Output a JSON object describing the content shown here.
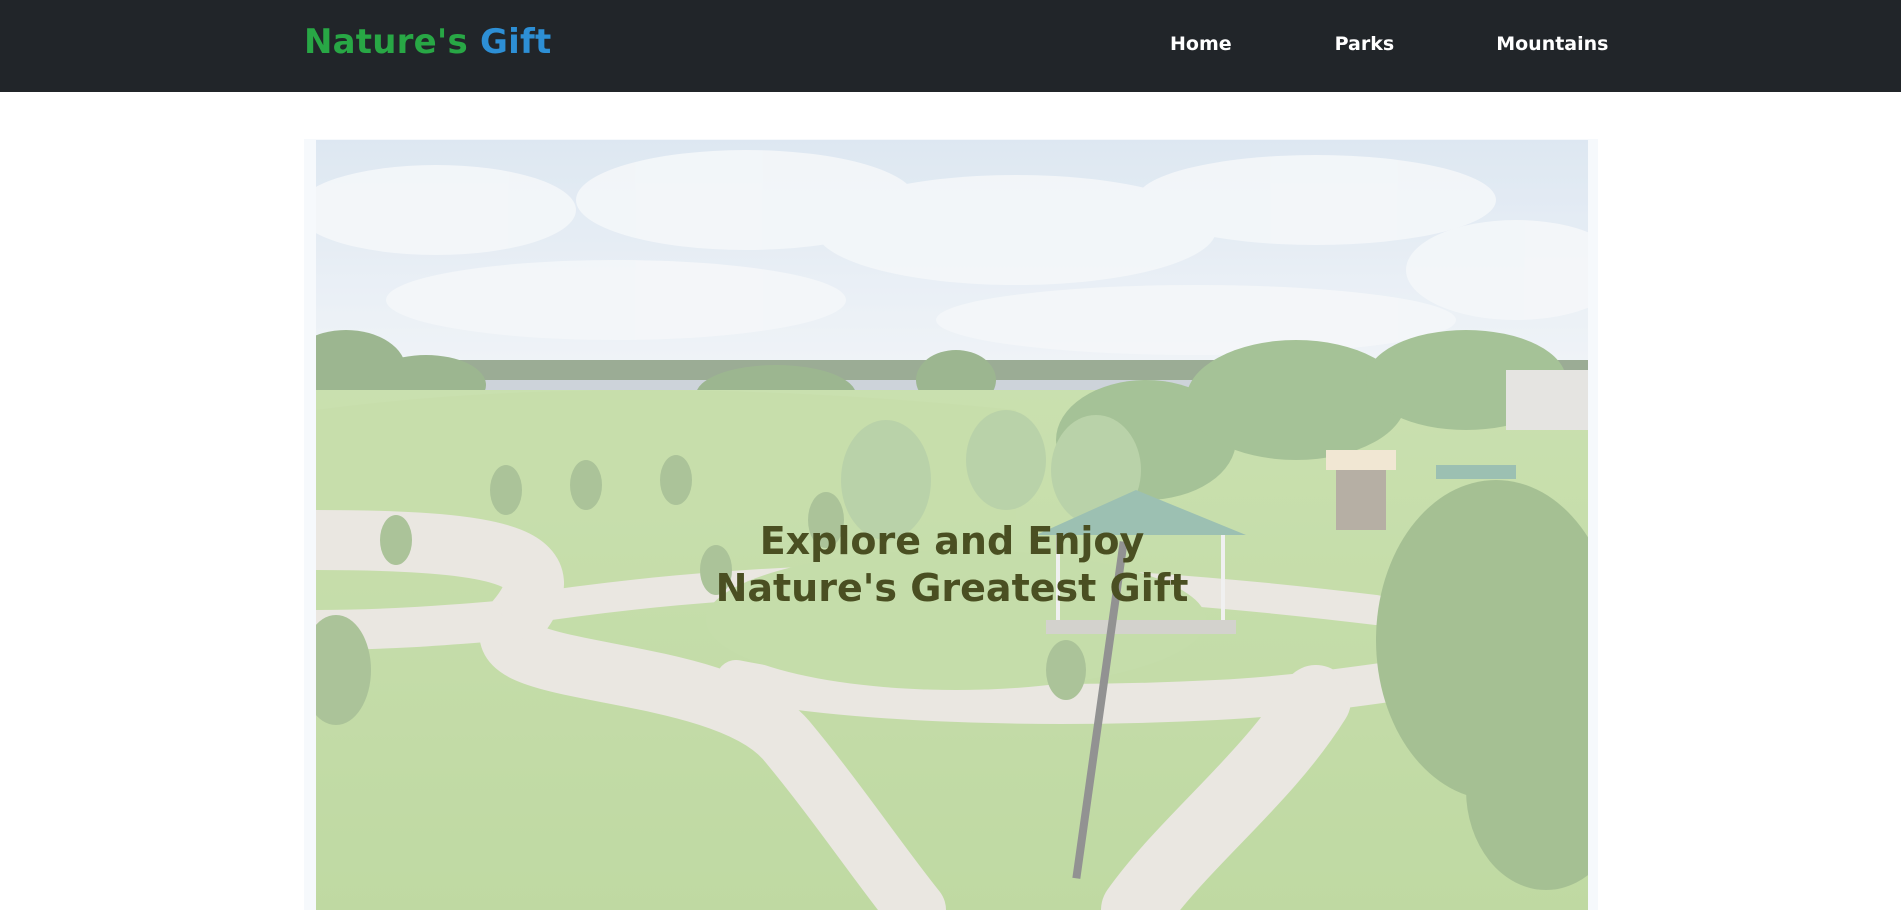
{
  "navbar": {
    "brand_part1": "Nature's",
    "brand_part2": "Gift",
    "links": [
      "Home",
      "Parks",
      "Mountains"
    ]
  },
  "hero": {
    "line1": "Explore and Enjoy",
    "line2": "Nature's Greatest Gift"
  },
  "colors": {
    "navbar_bg": "#212529",
    "brand_green": "#28a745",
    "brand_blue": "#2d8fd5",
    "hero_text": "#4a4f22"
  }
}
